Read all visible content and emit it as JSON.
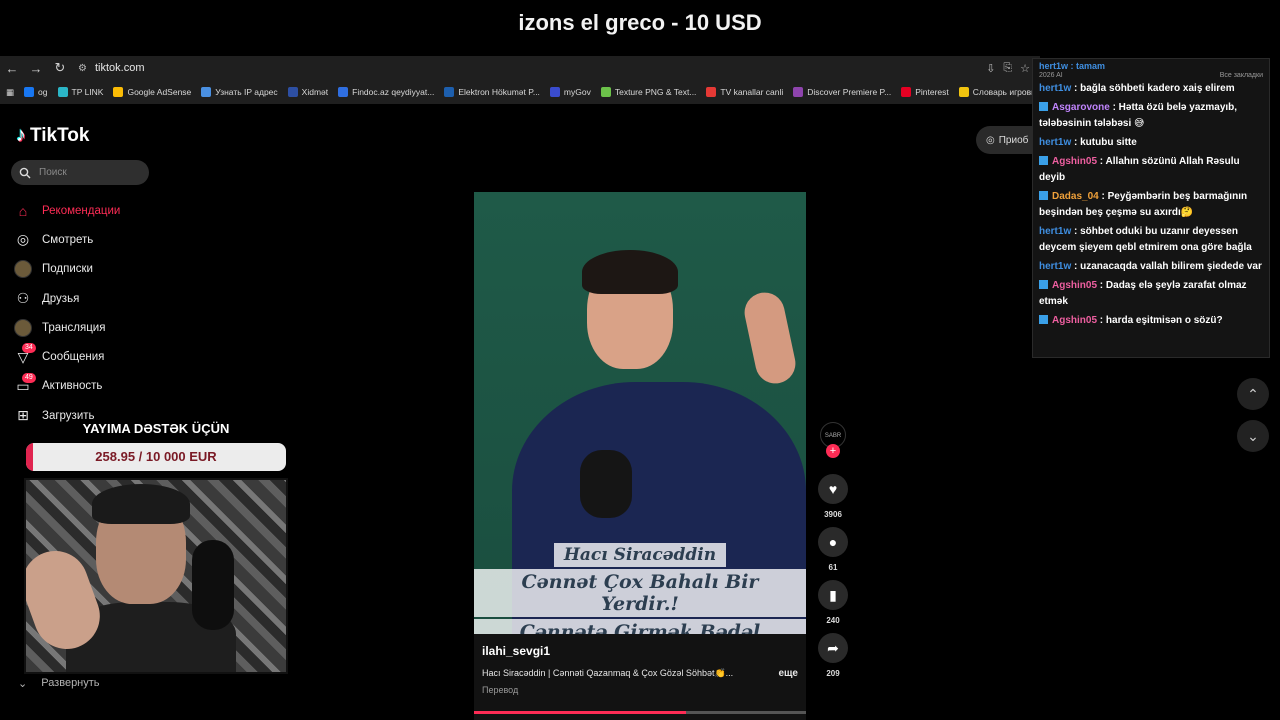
{
  "stream": {
    "title": "izons el greco - 10 USD"
  },
  "browser": {
    "url": "tiktok.com",
    "bookmarks": [
      {
        "label": "og",
        "color": "#1877f2"
      },
      {
        "label": "TP LINK",
        "color": "#2bb6c7"
      },
      {
        "label": "Google AdSense",
        "color": "#fbbc05"
      },
      {
        "label": "Узнать IP адрес",
        "color": "#4a90e2"
      },
      {
        "label": "Xidmət",
        "color": "#2d4fa3"
      },
      {
        "label": "Findoc.az qeydiyyat...",
        "color": "#2f6ee0"
      },
      {
        "label": "Elektron Hökumət P...",
        "color": "#1d5fae"
      },
      {
        "label": "myGov",
        "color": "#3a4ccf"
      },
      {
        "label": "Texture PNG & Text...",
        "color": "#6cc24a"
      },
      {
        "label": "TV kanallar canli",
        "color": "#e53935"
      },
      {
        "label": "Discover Premiere P...",
        "color": "#8e44ad"
      },
      {
        "label": "Pinterest",
        "color": "#e60023"
      },
      {
        "label": "Словарь игровых т...",
        "color": "#f1c40f"
      }
    ]
  },
  "tiktok": {
    "logo": "TikTok",
    "search_placeholder": "Поиск",
    "nav": [
      {
        "label": "Рекомендации",
        "icon": "home-icon",
        "glyph": "⌂",
        "badge": ""
      },
      {
        "label": "Смотреть",
        "icon": "compass-icon",
        "glyph": "◎",
        "badge": ""
      },
      {
        "label": "Подписки",
        "icon": "avatar",
        "glyph": "",
        "badge": ""
      },
      {
        "label": "Друзья",
        "icon": "friends-icon",
        "glyph": "⚇",
        "badge": ""
      },
      {
        "label": "Трансляция",
        "icon": "live-icon",
        "glyph": "",
        "badge": ""
      },
      {
        "label": "Сообщения",
        "icon": "messages-icon",
        "glyph": "▽",
        "badge": "34"
      },
      {
        "label": "Активность",
        "icon": "activity-icon",
        "glyph": "▭",
        "badge": "49"
      },
      {
        "label": "Загрузить",
        "icon": "upload-icon",
        "glyph": "⊞",
        "badge": ""
      }
    ],
    "expand_label": "Развернуть",
    "open_app_label": "Приоб",
    "video": {
      "author": "ilahi_sevgi1",
      "caption_name": "Hacı Siracəddin",
      "caption_line1": "Cənnət Çox Bahalı Bir Yerdir.!",
      "caption_line2": "Cənnətə Girmək Bədəl İstiyir.!",
      "description": "Hacı Siracəddin | Cənnəti Qazanmaq & Çox Gözəl Söhbət👏...",
      "more": "еще",
      "translate": "Перевод",
      "progress": 0.64,
      "creator_tag": "SABR"
    },
    "actions": [
      {
        "name": "like",
        "glyph": "♥",
        "count": "3906"
      },
      {
        "name": "comment",
        "glyph": "●",
        "count": "61"
      },
      {
        "name": "favorite",
        "glyph": "▮",
        "count": "240"
      },
      {
        "name": "share",
        "glyph": "➦",
        "count": "209"
      }
    ]
  },
  "chat": {
    "behind_left": "2026 AI",
    "behind_right": "Все закладки",
    "top_cut": "hert1w : tamam",
    "messages": [
      {
        "user": "hert1w",
        "color": "blue",
        "badge": false,
        "text": ": bağla söhbeti kadero xaiş elirem"
      },
      {
        "user": "Asgarovone",
        "color": "purple",
        "badge": true,
        "text": ": Hətta özü belə yazmayıb, tələbəsinin tələbəsi 😅"
      },
      {
        "user": "hert1w",
        "color": "blue",
        "badge": false,
        "text": ": kutubu sitte"
      },
      {
        "user": "Agshin05",
        "color": "pink",
        "badge": true,
        "text": ": Allahın sözünü Allah Rəsulu deyib"
      },
      {
        "user": "Dadas_04",
        "color": "orange",
        "badge": true,
        "text": ": Peyğəmbərin beş barmağının beşindən beş çeşmə su axırdı🤔"
      },
      {
        "user": "hert1w",
        "color": "blue",
        "badge": false,
        "text": ": söhbet oduki bu uzanır deyessen deycem şieyem qebl etmirem ona göre bağla"
      },
      {
        "user": "hert1w",
        "color": "blue",
        "badge": false,
        "text": ": uzanacaqda vallah bilirem şiedede var"
      },
      {
        "user": "Agshin05",
        "color": "pink",
        "badge": true,
        "text": ": Dadaş elə şeylə zarafat olmaz etmək"
      },
      {
        "user": "Agshin05",
        "color": "pink",
        "badge": true,
        "text": ": harda eşitmisən o sözü?"
      }
    ]
  },
  "goal": {
    "title": "YAYIMA DƏSTƏK ÜÇÜN",
    "text": "258.95 / 10 000 EUR",
    "fraction": 0.026
  },
  "colors": {
    "tiktok_red": "#fe2c55",
    "goal_red": "#e0244f"
  }
}
